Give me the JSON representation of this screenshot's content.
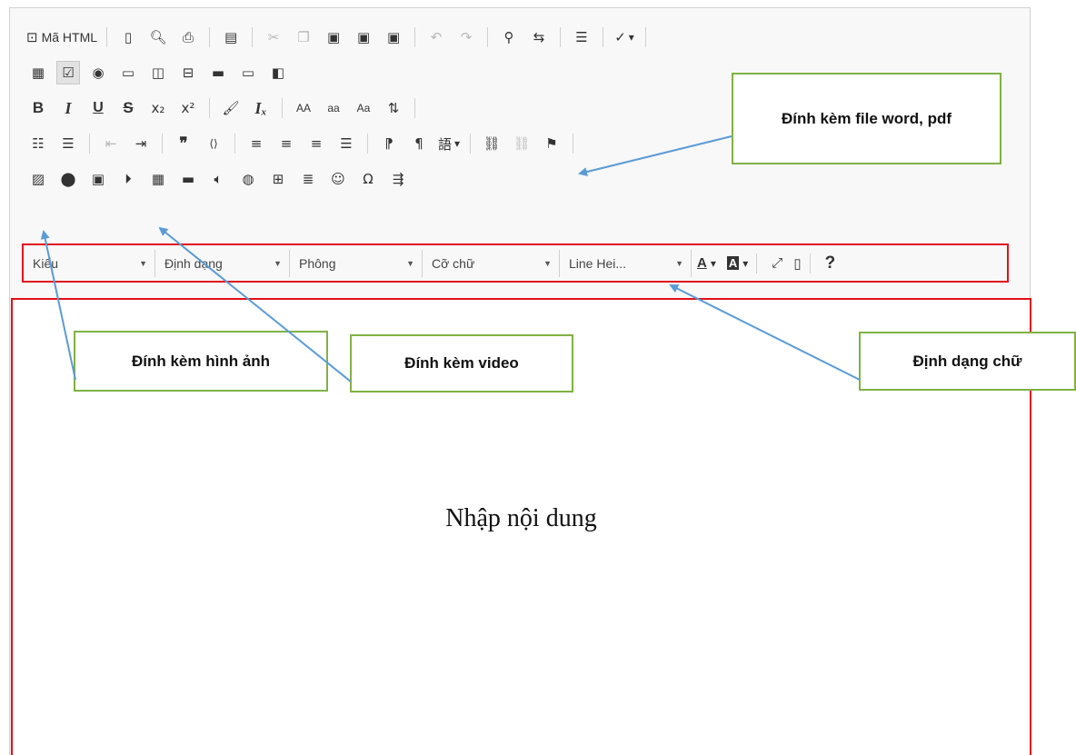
{
  "toolbar": {
    "source_label": "Mã HTML",
    "style_combo": "Kiểu",
    "format_combo": "Định dạng",
    "font_combo": "Phông",
    "size_combo": "Cỡ chữ",
    "lineheight_combo": "Line Hei...",
    "text_color_label": "A",
    "bg_color_label": "A",
    "help_label": "?",
    "bold_label": "B",
    "italic_label": "I",
    "underline_label": "U",
    "strike_label": "S",
    "upper_label": "AA",
    "lower_label": "aa",
    "capital_label": "Aa",
    "icons": [
      "source-icon",
      "new-page-icon",
      "preview-icon",
      "print-icon",
      "templates-icon",
      "cut-icon",
      "copy-icon",
      "paste-icon",
      "paste-text-icon",
      "paste-word-icon",
      "undo-icon",
      "redo-icon",
      "find-icon",
      "replace-icon",
      "select-all-icon",
      "spellcheck-icon",
      "form-icon",
      "checkbox-icon",
      "radio-icon",
      "textfield-icon",
      "textarea-icon",
      "select-icon",
      "button-icon",
      "image-button-icon",
      "hidden-field-icon",
      "numbered-list-icon",
      "bulleted-list-icon",
      "outdent-icon",
      "indent-icon",
      "blockquote-icon",
      "div-icon",
      "align-left-icon",
      "align-center-icon",
      "align-right-icon",
      "justify-icon",
      "ltr-icon",
      "rtl-icon",
      "language-icon",
      "link-icon",
      "unlink-icon",
      "anchor-icon",
      "image-icon",
      "flash-icon",
      "youtube-icon",
      "video-icon",
      "media-icon",
      "iframe-icon",
      "audio-icon",
      "map-icon",
      "table-icon",
      "horizontal-rule-icon",
      "smiley-icon",
      "special-char-icon",
      "page-break-icon",
      "maximize-icon",
      "show-blocks-icon"
    ]
  },
  "editor": {
    "placeholder": "Nhập nội dung"
  },
  "callouts": {
    "attach_file": "Đính kèm file word, pdf",
    "attach_image": "Đính kèm hình ảnh",
    "attach_video": "Đính kèm video",
    "text_format": "Định dạng chữ"
  },
  "colors": {
    "highlight_border": "#e0101a",
    "callout_border": "#7fb244",
    "arrow": "#5b9bd5"
  }
}
